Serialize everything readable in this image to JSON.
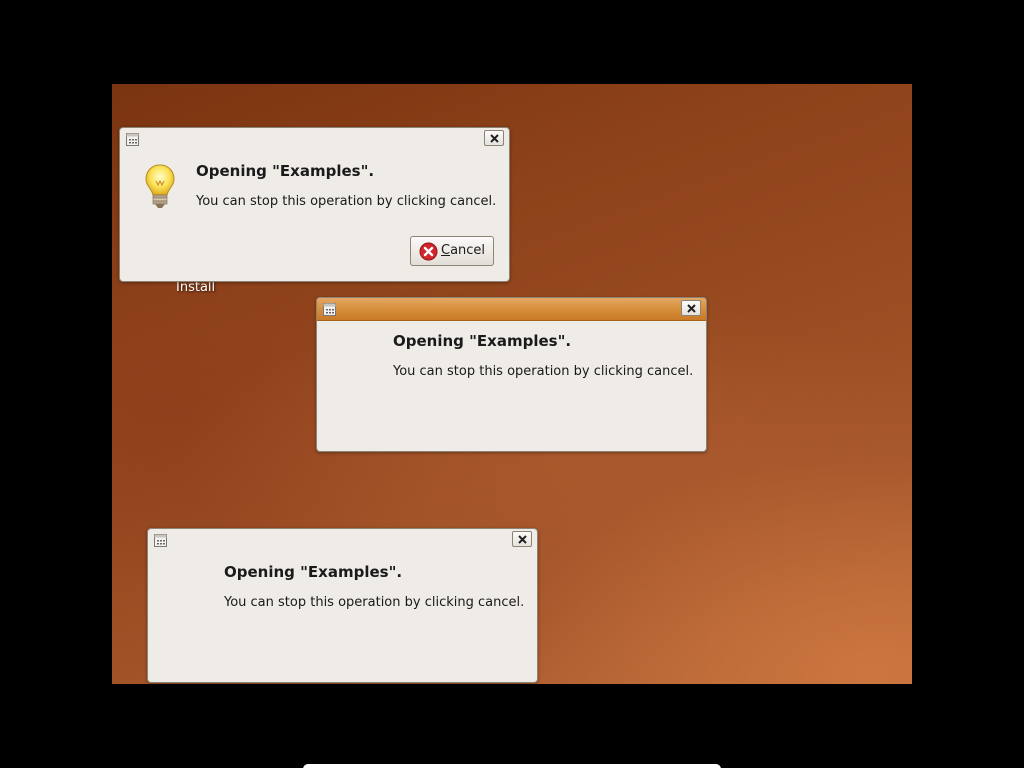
{
  "desktop": {
    "icon_label": "Install"
  },
  "dialogs": [
    {
      "heading": "Opening \"Examples\".",
      "message": "You can stop this operation by clicking cancel.",
      "cancel_first_letter": "C",
      "cancel_rest": "ancel",
      "icon": "lightbulb-icon",
      "state": "inactive"
    },
    {
      "heading": "Opening \"Examples\".",
      "message": "You can stop this operation by clicking cancel.",
      "state": "active"
    },
    {
      "heading": "Opening \"Examples\".",
      "message": "You can stop this operation by clicking cancel.",
      "state": "inactive"
    }
  ],
  "colors": {
    "active_titlebar": "#d8913e",
    "dialog_bg": "#efebe7",
    "cancel_icon_red": "#d4262a"
  }
}
